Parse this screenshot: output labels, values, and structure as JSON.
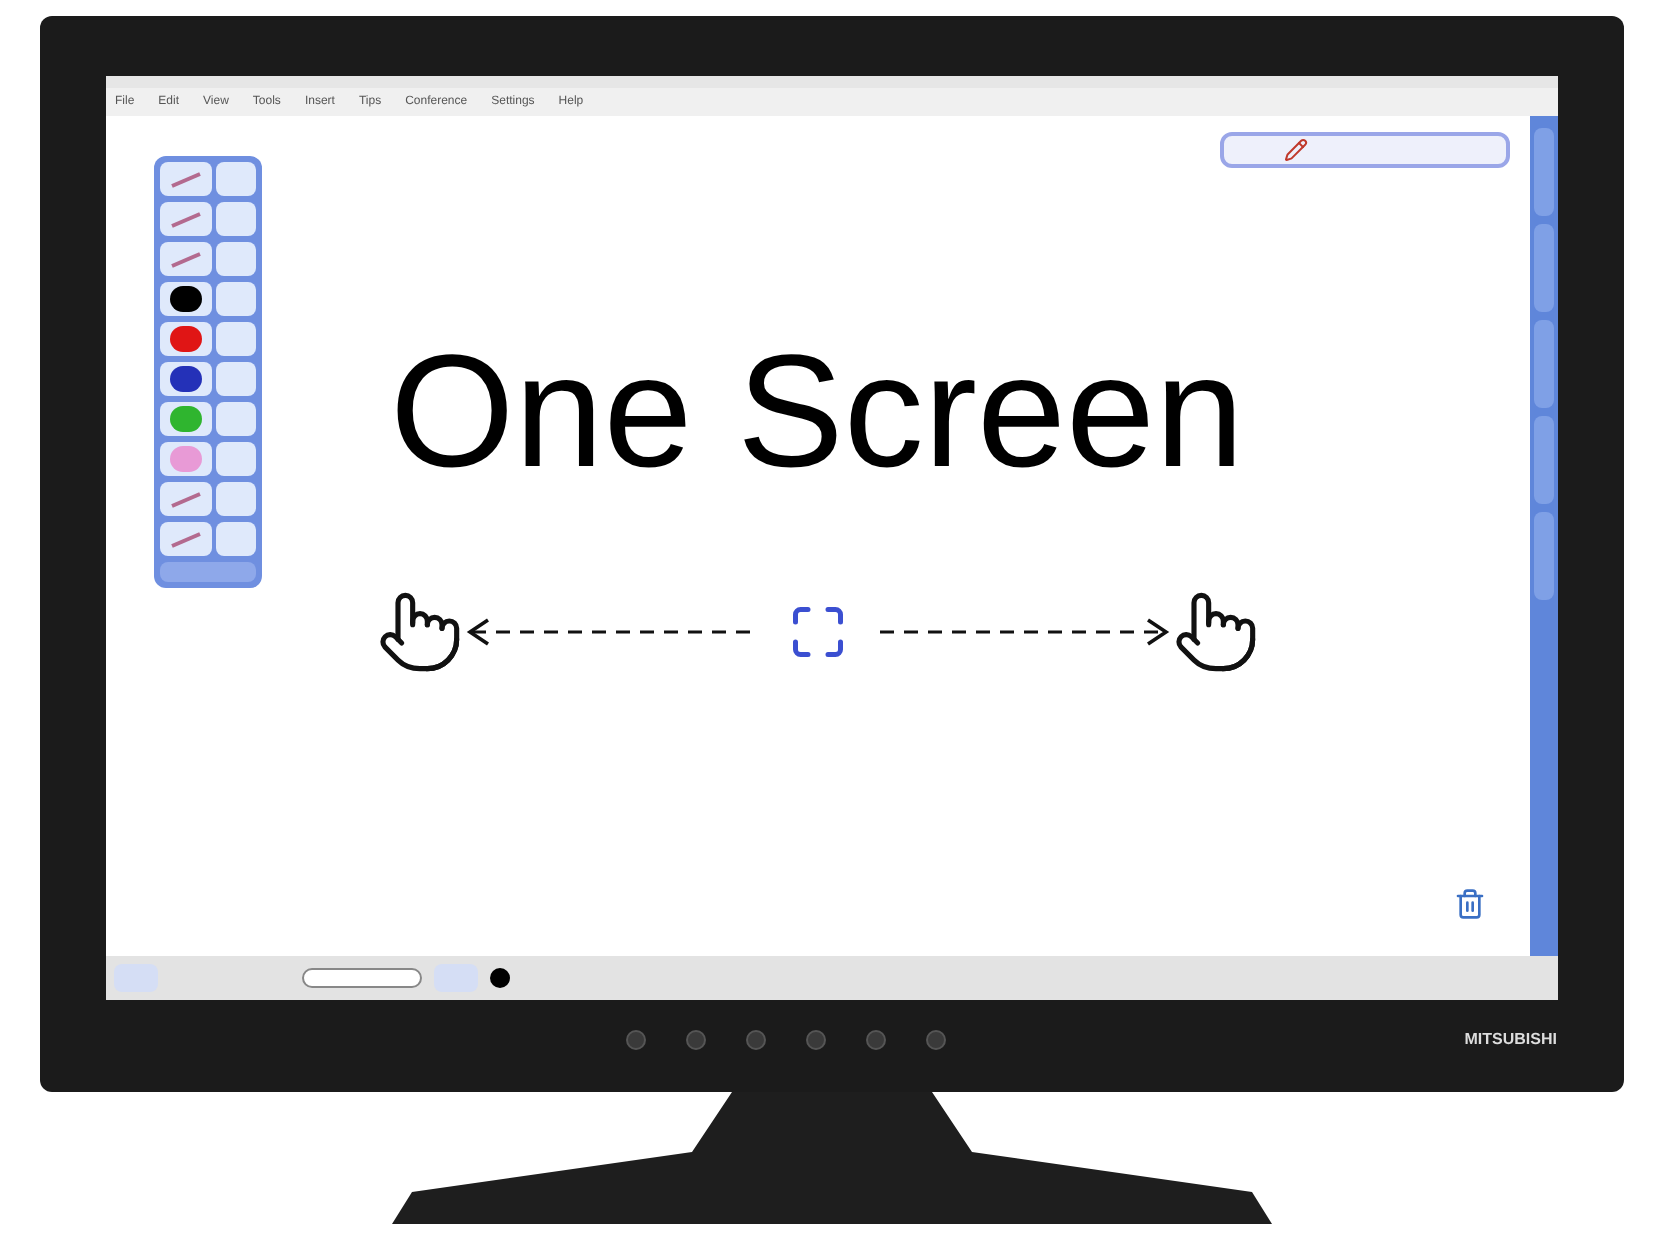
{
  "menu": [
    "File",
    "Edit",
    "View",
    "Tools",
    "Insert",
    "Tips",
    "Conference",
    "Settings",
    "Help"
  ],
  "palette": [
    {
      "kind": "tool"
    },
    {
      "kind": "tool"
    },
    {
      "kind": "tool"
    },
    {
      "kind": "color",
      "color": "#000000"
    },
    {
      "kind": "color",
      "color": "#e01515"
    },
    {
      "kind": "color",
      "color": "#2431b8"
    },
    {
      "kind": "color",
      "color": "#2fb52f"
    },
    {
      "kind": "color",
      "color": "#e89ad6"
    },
    {
      "kind": "tool"
    },
    {
      "kind": "tool"
    }
  ],
  "headline": "One Screen",
  "pen": {
    "color": "#000000"
  },
  "brand": "MITSUBISHI"
}
